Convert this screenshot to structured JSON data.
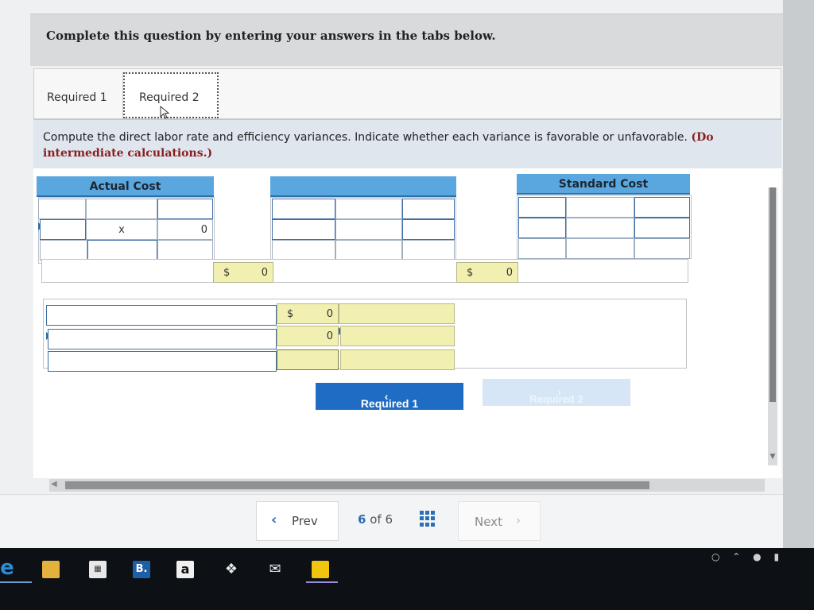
{
  "header": {
    "text": "Complete this question by entering your answers in the tabs below."
  },
  "tabs": [
    {
      "label": "Required 1"
    },
    {
      "label": "Required 2"
    }
  ],
  "instruction": {
    "text": "Compute the direct labor rate and efficiency variances. Indicate whether each variance is favorable or unfavorable.",
    "bold": "(Do not round intermediate calculations.)",
    "bold_visible_start": "(Do",
    "bold_visible_end": "intermediate calculations.)"
  },
  "columns": {
    "actual_cost": "Actual Cost",
    "middle": "",
    "standard_cost": "Standard Cost"
  },
  "grid": {
    "multiply_symbol": "x",
    "actual_result": "0",
    "currency": "$",
    "actual_total": "0",
    "standard_total": "0",
    "variance_1": "0",
    "variance_2": "0"
  },
  "nav_buttons": {
    "prev_required": "Required 1",
    "next_required": "Required 2"
  },
  "footer": {
    "prev": "Prev",
    "page_current": "6",
    "page_of": "of",
    "page_total": "6",
    "next": "Next"
  },
  "taskbar": {
    "icons": [
      "edge-icon",
      "folder-icon",
      "store-icon",
      "b-app-icon",
      "amazon-icon",
      "dropbox-icon",
      "mail-icon",
      "sticky-notes-icon"
    ],
    "bold_app_letter": "B.",
    "amazon_letter": "a"
  },
  "colors": {
    "header_blue": "#5aa7e0",
    "input_yellow": "#f2f0b0",
    "primary_button": "#1f6cc4",
    "disabled_button": "#d6e6f6",
    "instruction_emphasis": "#8a1e1e"
  }
}
